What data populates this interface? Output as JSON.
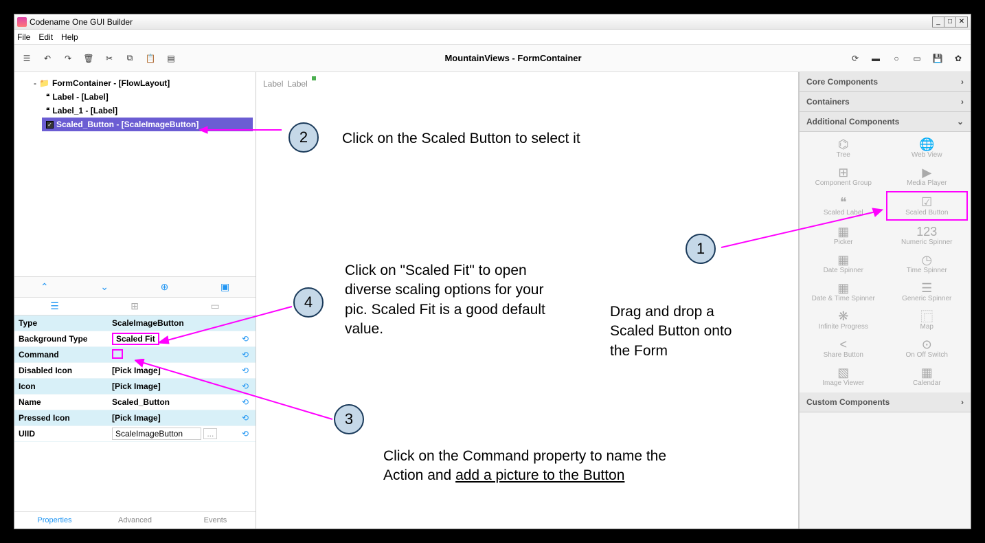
{
  "titlebar": {
    "title": "Codename One GUI Builder"
  },
  "menu": {
    "file": "File",
    "edit": "Edit",
    "help": "Help"
  },
  "form_title": "MountainViews - FormContainer",
  "tree": {
    "root": "FormContainer - [FlowLayout]",
    "label0": "Label - [Label]",
    "label1": "Label_1 - [Label]",
    "scaled": "Scaled_Button - [ScaleImageButton]"
  },
  "canvas": {
    "label0": "Label",
    "label1": "Label"
  },
  "props": {
    "type_l": "Type",
    "type_v": "ScaleImageButton",
    "bg_l": "Background Type",
    "bg_v": "Scaled Fit",
    "cmd_l": "Command",
    "dis_l": "Disabled Icon",
    "dis_v": "[Pick Image]",
    "icon_l": "Icon",
    "icon_v": "[Pick Image]",
    "name_l": "Name",
    "name_v": "Scaled_Button",
    "press_l": "Pressed Icon",
    "press_v": "[Pick Image]",
    "uiid_l": "UIID",
    "uiid_v": "ScaleImageButton",
    "ellipsis": "..."
  },
  "prop_tabs": {
    "props": "Properties",
    "adv": "Advanced",
    "events": "Events"
  },
  "accordion": {
    "core": "Core Components",
    "containers": "Containers",
    "additional": "Additional Components",
    "custom": "Custom Components"
  },
  "comps": {
    "tree": "Tree",
    "webview": "Web View",
    "compgroup": "Component Group",
    "mediaplayer": "Media Player",
    "scaledlabel": "Scaled Label",
    "scaledbutton": "Scaled Button",
    "picker": "Picker",
    "numspinner": "Numeric Spinner",
    "datespinner": "Date Spinner",
    "timespinner": "Time Spinner",
    "dtspinner": "Date & Time Spinner",
    "genspinner": "Generic Spinner",
    "infprogress": "Infinite Progress",
    "map": "Map",
    "sharebutton": "Share Button",
    "onoff": "On Off Switch",
    "imageviewer": "Image Viewer",
    "calendar": "Calendar"
  },
  "anno": {
    "n1": "1",
    "n2": "2",
    "n3": "3",
    "n4": "4",
    "t1": "Drag and drop a Scaled Button onto the Form",
    "t2": "Click on the Scaled Button to select it",
    "t3a": "Click on the Command property to name the Action and ",
    "t3b": "add a picture to the Button",
    "t4": "Click on \"Scaled Fit\" to open diverse scaling options for your pic. Scaled Fit is a good default value."
  }
}
